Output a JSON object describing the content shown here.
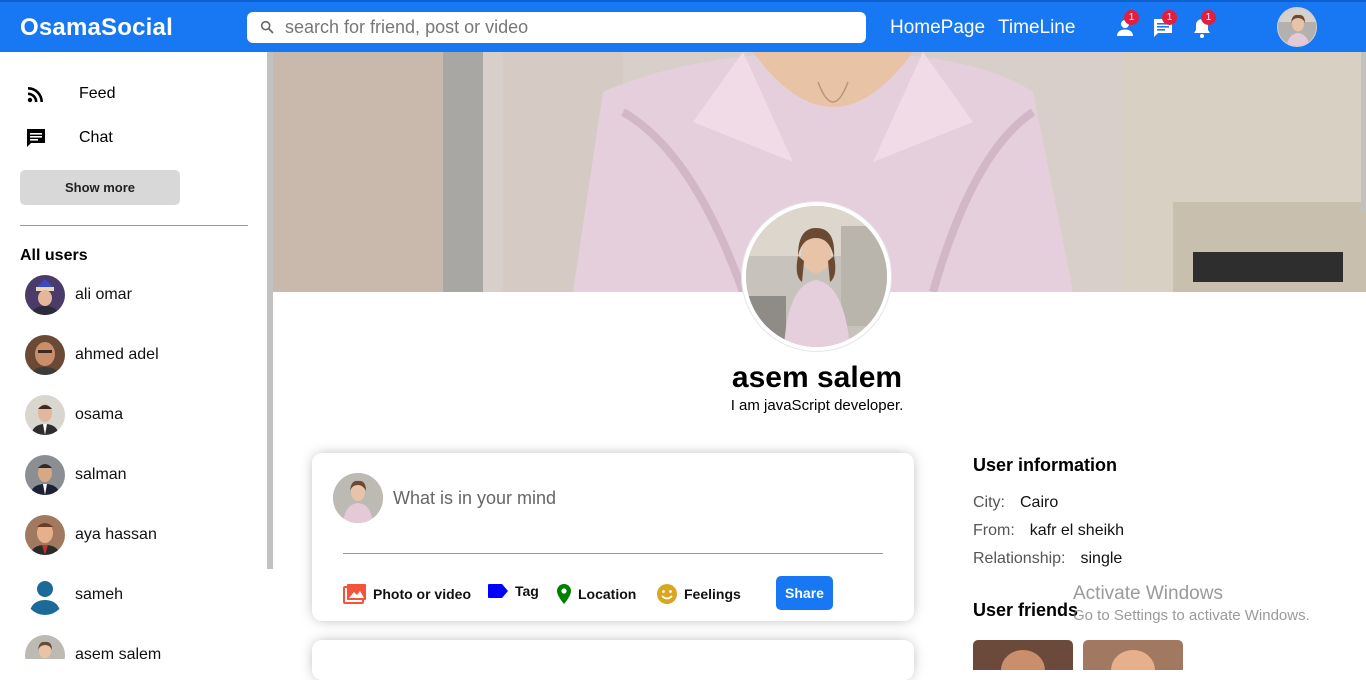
{
  "header": {
    "logo": "OsamaSocial",
    "search_placeholder": "search for friend, post or video",
    "links": [
      "HomePage",
      "TimeLine"
    ],
    "badges": {
      "friends": "1",
      "messages": "1",
      "notifications": "1"
    }
  },
  "sidebar": {
    "items": [
      {
        "label": "Feed",
        "icon": "rss-feed-icon"
      },
      {
        "label": "Chat",
        "icon": "chat-icon"
      }
    ],
    "show_more_label": "Show more",
    "all_users_title": "All users",
    "users": [
      "ali omar",
      "ahmed adel",
      "osama",
      "salman",
      "aya hassan",
      "sameh",
      "asem salem"
    ]
  },
  "profile": {
    "name": "asem salem",
    "description": "I am javaScript developer."
  },
  "share": {
    "placeholder": "What is in your mind",
    "options": [
      {
        "label": "Photo or video",
        "icon": "photo-icon",
        "color": "#f3533b"
      },
      {
        "label": "Tag",
        "icon": "tag-icon",
        "color": "#0000ff"
      },
      {
        "label": "Location",
        "icon": "location-icon",
        "color": "#008000"
      },
      {
        "label": "Feelings",
        "icon": "emoji-icon",
        "color": "#daa520"
      }
    ],
    "share_label": "Share"
  },
  "info": {
    "title": "User information",
    "rows": [
      {
        "key": "City:",
        "value": "Cairo"
      },
      {
        "key": "From:",
        "value": "kafr el sheikh"
      },
      {
        "key": "Relationship:",
        "value": "single"
      }
    ],
    "friends_title": "User friends"
  },
  "watermark": {
    "line1": "Activate Windows",
    "line2": "Go to Settings to activate Windows."
  },
  "colors": {
    "primary": "#1877f2",
    "badge": "#e41e3f"
  }
}
